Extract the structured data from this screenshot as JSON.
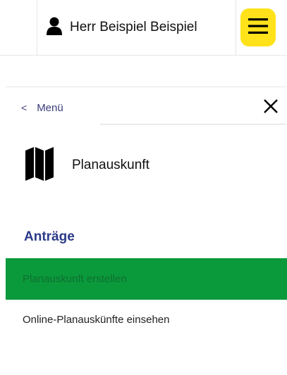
{
  "header": {
    "user_label": "Herr Beispiel Beispiel",
    "user_icon": "person-icon",
    "menu_icon": "hamburger-menu-icon",
    "accent_color": "#ffe21a"
  },
  "nav": {
    "back_label": "Menü",
    "back_icon": "chevron-left-icon",
    "close_icon": "close-icon"
  },
  "section": {
    "title": "Planauskunft",
    "icon": "map-icon"
  },
  "group": {
    "title": "Anträge",
    "items": [
      {
        "label": "Planauskunft erstellen",
        "active": true,
        "color": "#0a9a3b"
      },
      {
        "label": "Online-Planauskünfte einsehen",
        "active": false
      }
    ]
  }
}
